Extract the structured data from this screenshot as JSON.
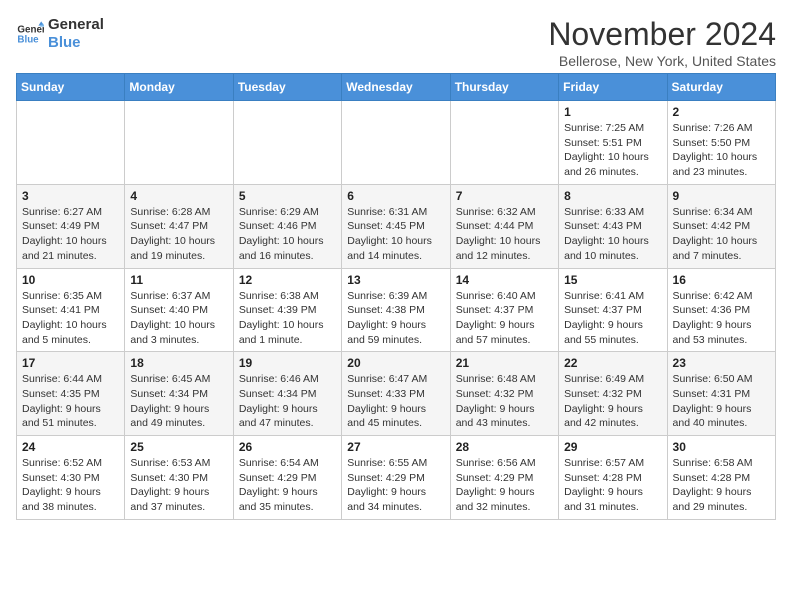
{
  "logo": {
    "line1": "General",
    "line2": "Blue"
  },
  "title": "November 2024",
  "subtitle": "Bellerose, New York, United States",
  "weekdays": [
    "Sunday",
    "Monday",
    "Tuesday",
    "Wednesday",
    "Thursday",
    "Friday",
    "Saturday"
  ],
  "weeks": [
    [
      {
        "day": "",
        "info": ""
      },
      {
        "day": "",
        "info": ""
      },
      {
        "day": "",
        "info": ""
      },
      {
        "day": "",
        "info": ""
      },
      {
        "day": "",
        "info": ""
      },
      {
        "day": "1",
        "info": "Sunrise: 7:25 AM\nSunset: 5:51 PM\nDaylight: 10 hours and 26 minutes."
      },
      {
        "day": "2",
        "info": "Sunrise: 7:26 AM\nSunset: 5:50 PM\nDaylight: 10 hours and 23 minutes."
      }
    ],
    [
      {
        "day": "3",
        "info": "Sunrise: 6:27 AM\nSunset: 4:49 PM\nDaylight: 10 hours and 21 minutes."
      },
      {
        "day": "4",
        "info": "Sunrise: 6:28 AM\nSunset: 4:47 PM\nDaylight: 10 hours and 19 minutes."
      },
      {
        "day": "5",
        "info": "Sunrise: 6:29 AM\nSunset: 4:46 PM\nDaylight: 10 hours and 16 minutes."
      },
      {
        "day": "6",
        "info": "Sunrise: 6:31 AM\nSunset: 4:45 PM\nDaylight: 10 hours and 14 minutes."
      },
      {
        "day": "7",
        "info": "Sunrise: 6:32 AM\nSunset: 4:44 PM\nDaylight: 10 hours and 12 minutes."
      },
      {
        "day": "8",
        "info": "Sunrise: 6:33 AM\nSunset: 4:43 PM\nDaylight: 10 hours and 10 minutes."
      },
      {
        "day": "9",
        "info": "Sunrise: 6:34 AM\nSunset: 4:42 PM\nDaylight: 10 hours and 7 minutes."
      }
    ],
    [
      {
        "day": "10",
        "info": "Sunrise: 6:35 AM\nSunset: 4:41 PM\nDaylight: 10 hours and 5 minutes."
      },
      {
        "day": "11",
        "info": "Sunrise: 6:37 AM\nSunset: 4:40 PM\nDaylight: 10 hours and 3 minutes."
      },
      {
        "day": "12",
        "info": "Sunrise: 6:38 AM\nSunset: 4:39 PM\nDaylight: 10 hours and 1 minute."
      },
      {
        "day": "13",
        "info": "Sunrise: 6:39 AM\nSunset: 4:38 PM\nDaylight: 9 hours and 59 minutes."
      },
      {
        "day": "14",
        "info": "Sunrise: 6:40 AM\nSunset: 4:37 PM\nDaylight: 9 hours and 57 minutes."
      },
      {
        "day": "15",
        "info": "Sunrise: 6:41 AM\nSunset: 4:37 PM\nDaylight: 9 hours and 55 minutes."
      },
      {
        "day": "16",
        "info": "Sunrise: 6:42 AM\nSunset: 4:36 PM\nDaylight: 9 hours and 53 minutes."
      }
    ],
    [
      {
        "day": "17",
        "info": "Sunrise: 6:44 AM\nSunset: 4:35 PM\nDaylight: 9 hours and 51 minutes."
      },
      {
        "day": "18",
        "info": "Sunrise: 6:45 AM\nSunset: 4:34 PM\nDaylight: 9 hours and 49 minutes."
      },
      {
        "day": "19",
        "info": "Sunrise: 6:46 AM\nSunset: 4:34 PM\nDaylight: 9 hours and 47 minutes."
      },
      {
        "day": "20",
        "info": "Sunrise: 6:47 AM\nSunset: 4:33 PM\nDaylight: 9 hours and 45 minutes."
      },
      {
        "day": "21",
        "info": "Sunrise: 6:48 AM\nSunset: 4:32 PM\nDaylight: 9 hours and 43 minutes."
      },
      {
        "day": "22",
        "info": "Sunrise: 6:49 AM\nSunset: 4:32 PM\nDaylight: 9 hours and 42 minutes."
      },
      {
        "day": "23",
        "info": "Sunrise: 6:50 AM\nSunset: 4:31 PM\nDaylight: 9 hours and 40 minutes."
      }
    ],
    [
      {
        "day": "24",
        "info": "Sunrise: 6:52 AM\nSunset: 4:30 PM\nDaylight: 9 hours and 38 minutes."
      },
      {
        "day": "25",
        "info": "Sunrise: 6:53 AM\nSunset: 4:30 PM\nDaylight: 9 hours and 37 minutes."
      },
      {
        "day": "26",
        "info": "Sunrise: 6:54 AM\nSunset: 4:29 PM\nDaylight: 9 hours and 35 minutes."
      },
      {
        "day": "27",
        "info": "Sunrise: 6:55 AM\nSunset: 4:29 PM\nDaylight: 9 hours and 34 minutes."
      },
      {
        "day": "28",
        "info": "Sunrise: 6:56 AM\nSunset: 4:29 PM\nDaylight: 9 hours and 32 minutes."
      },
      {
        "day": "29",
        "info": "Sunrise: 6:57 AM\nSunset: 4:28 PM\nDaylight: 9 hours and 31 minutes."
      },
      {
        "day": "30",
        "info": "Sunrise: 6:58 AM\nSunset: 4:28 PM\nDaylight: 9 hours and 29 minutes."
      }
    ]
  ]
}
